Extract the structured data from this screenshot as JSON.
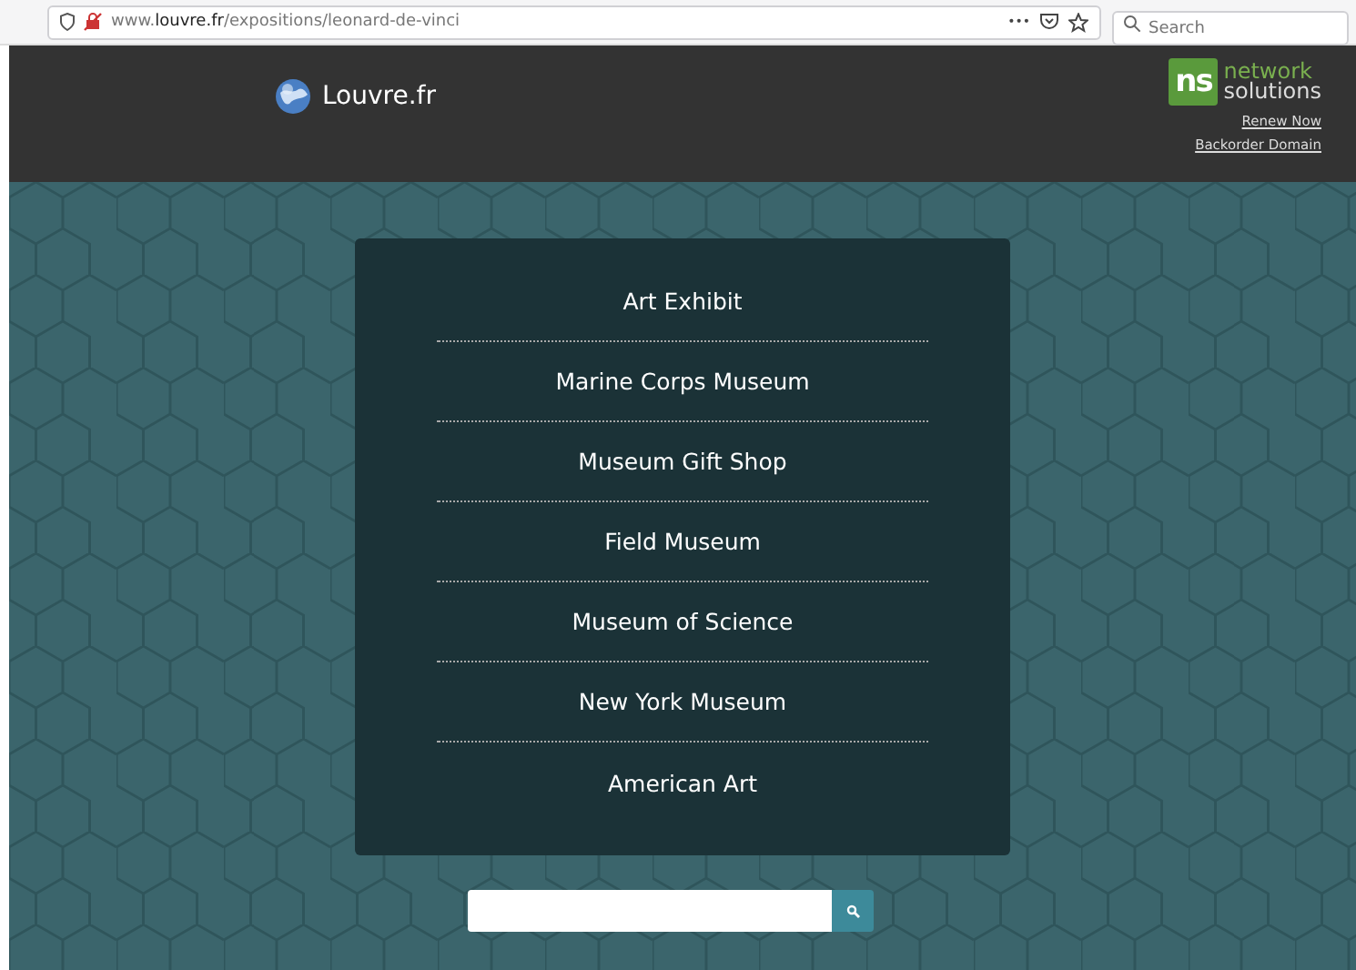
{
  "browser": {
    "url": {
      "prefix": "www.",
      "domain": "louvre.fr",
      "path": "/expositions/leonard-de-vinci"
    },
    "more": "•••",
    "search": {
      "placeholder": "Search"
    }
  },
  "header": {
    "site_name": "Louvre.fr",
    "sponsor": {
      "mark": "ns",
      "name_1": "network",
      "name_2": "solutions",
      "links": [
        "Renew Now",
        "Backorder Domain"
      ]
    }
  },
  "menu": [
    "Art Exhibit",
    "Marine Corps Museum",
    "Museum Gift Shop",
    "Field Museum",
    "Museum of Science",
    "New York Museum",
    "American Art"
  ],
  "search_button": {
    "kind": "icon"
  }
}
